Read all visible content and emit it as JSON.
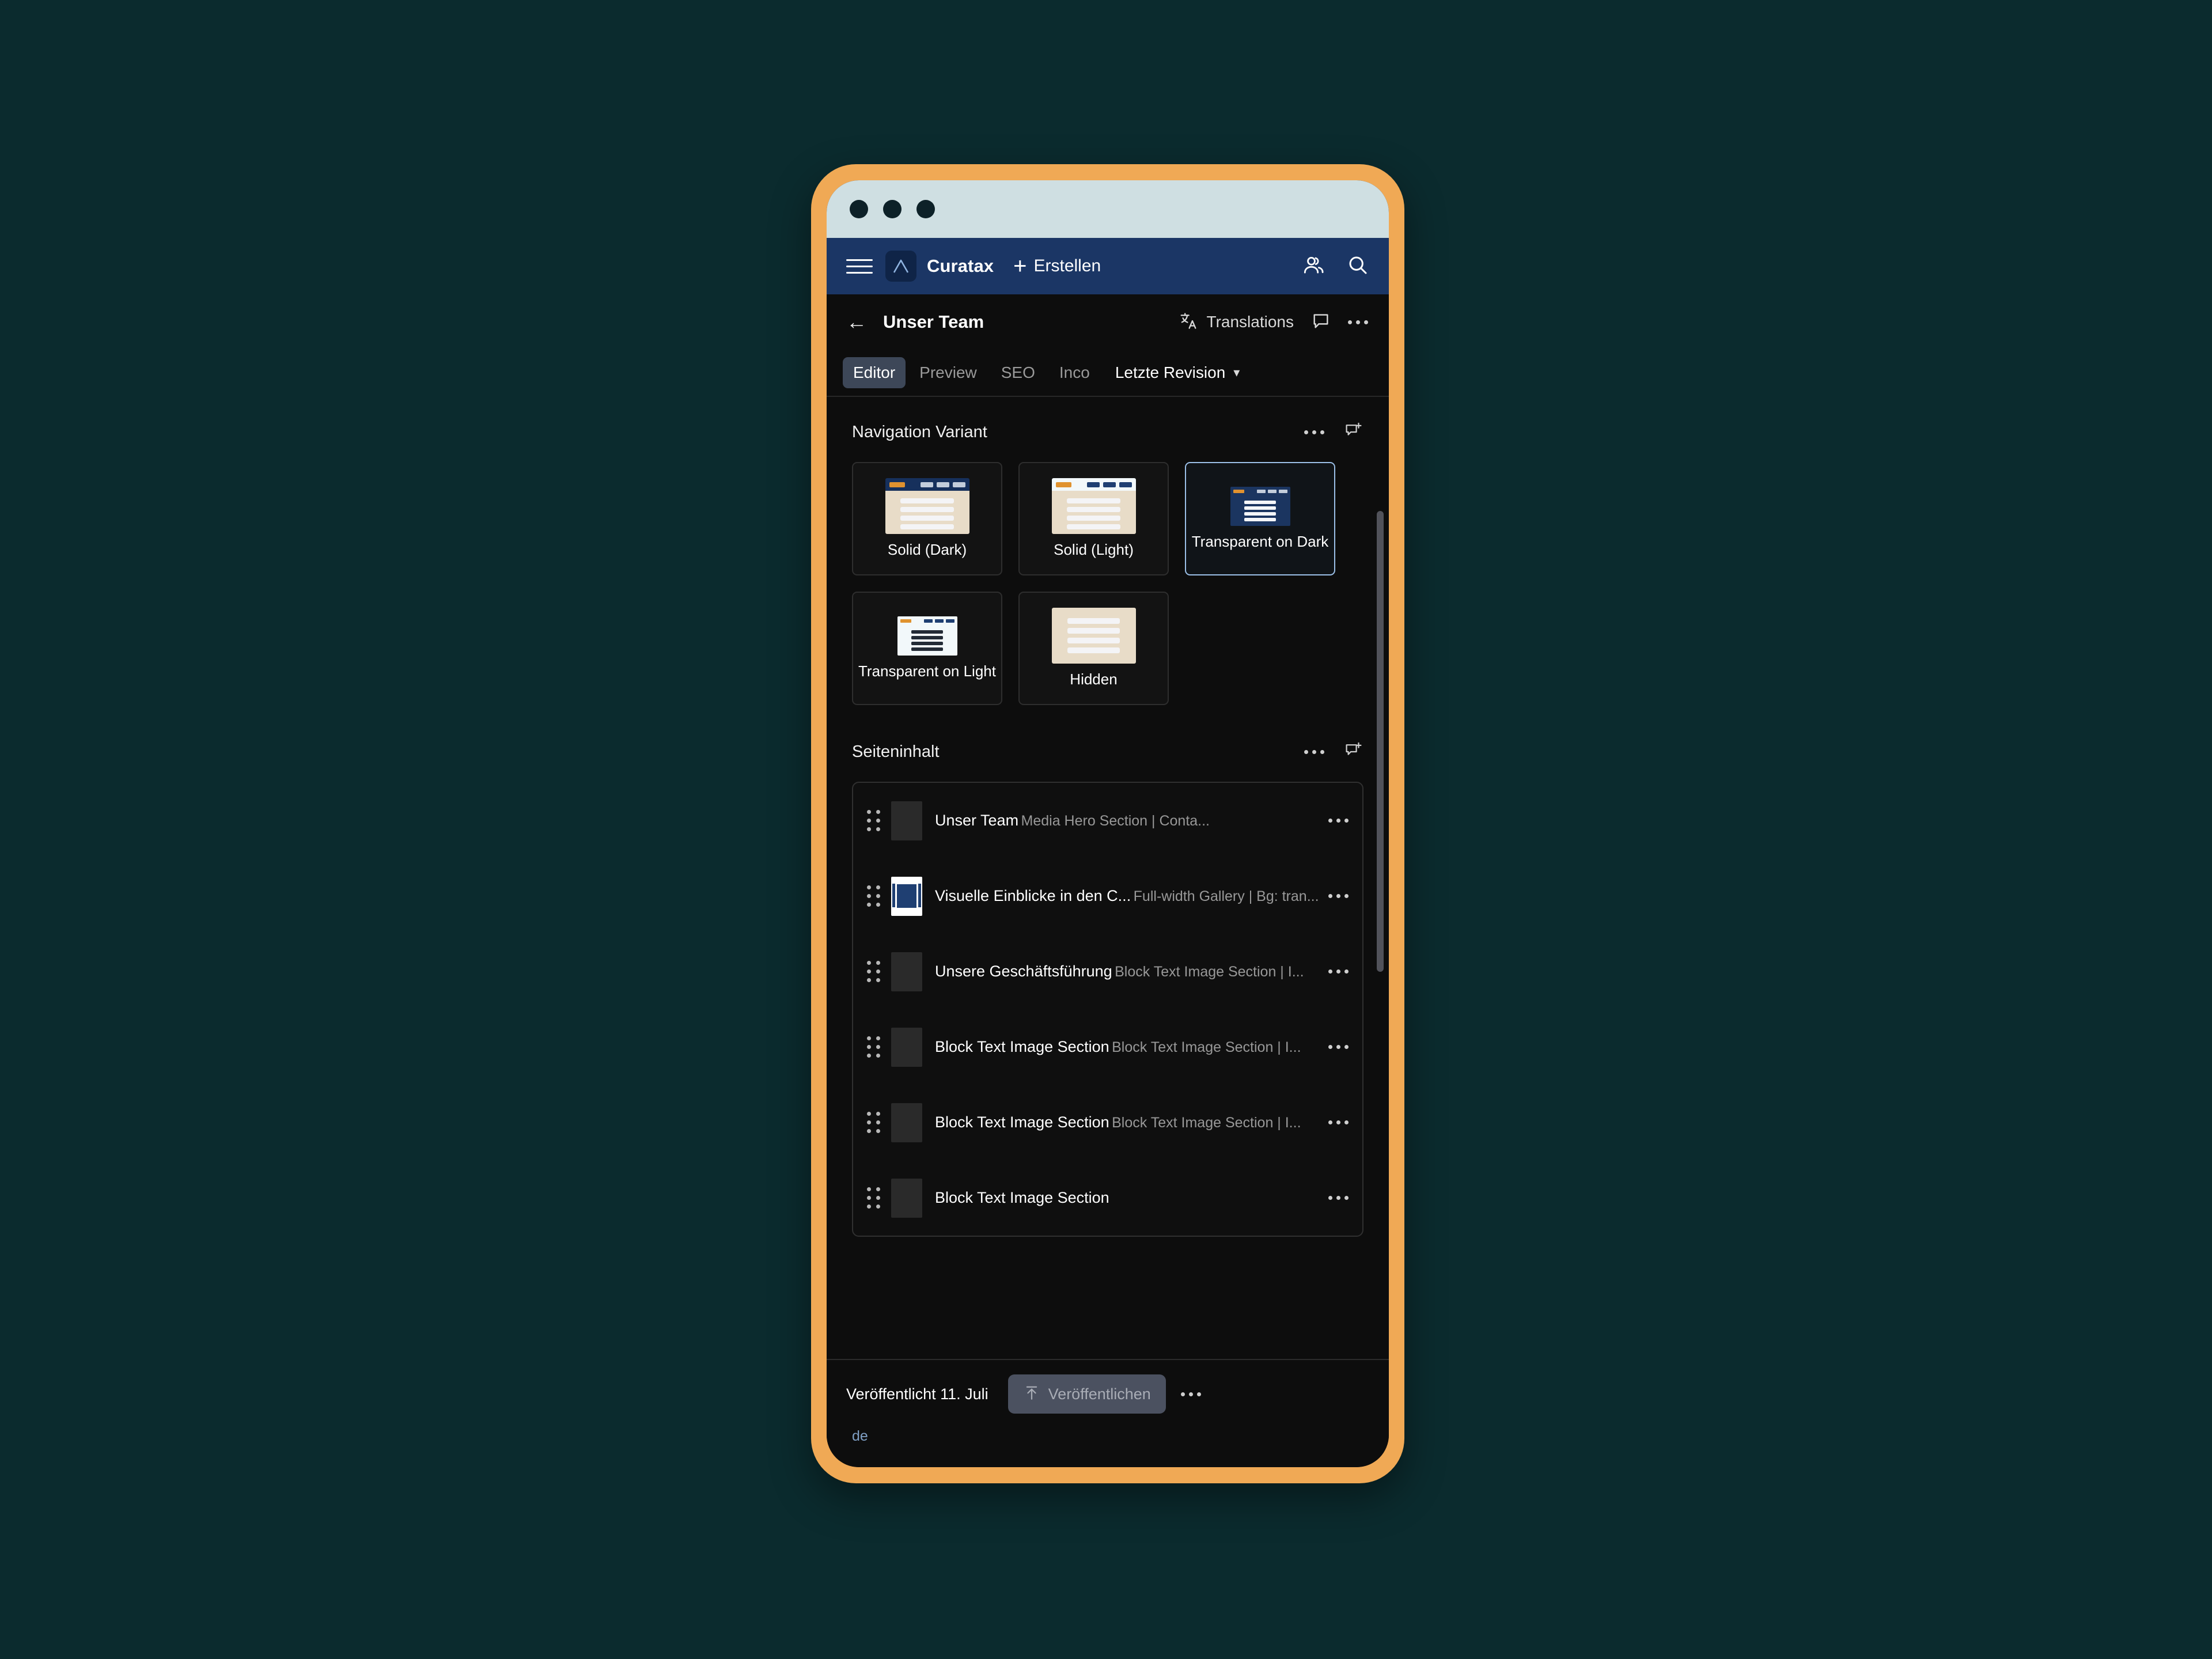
{
  "colors": {
    "page_background": "#0b2b2e",
    "frame": "#f0a955",
    "browser_chrome": "#cfdfe2",
    "app_bar": "#1b3665",
    "screen": "#0d0d0d",
    "accent_orange": "#e0922f",
    "accent_blue": "#1f3f72",
    "selected_border": "#9cc0e8"
  },
  "browser": {
    "dots": [
      "close",
      "minimize",
      "maximize"
    ]
  },
  "topbar": {
    "menu_icon": "hamburger-icon",
    "logo_icon": "curatax-logo-icon",
    "brand": "Curatax",
    "create_label": "Erstellen",
    "create_icon": "plus-icon",
    "people_icon": "people-icon",
    "search_icon": "search-icon"
  },
  "header": {
    "back_icon": "back-arrow-icon",
    "title": "Unser Team",
    "translations_label": "Translations",
    "translations_icon": "translate-icon",
    "comment_icon": "comment-icon",
    "more_icon": "more-icon"
  },
  "tabs": {
    "items": [
      {
        "label": "Editor",
        "active": true
      },
      {
        "label": "Preview",
        "active": false
      },
      {
        "label": "SEO",
        "active": false
      },
      {
        "label": "Inco",
        "active": false
      }
    ],
    "revision_label": "Letzte Revision",
    "revision_chevron": "chevron-down-icon"
  },
  "navigation_variant": {
    "title": "Navigation Variant",
    "more_icon": "more-icon",
    "comment_add_icon": "comment-add-icon",
    "options": [
      {
        "label": "Solid (Dark)",
        "thumb": "full-dark",
        "selected": false
      },
      {
        "label": "Solid (Light)",
        "thumb": "full-light",
        "selected": false
      },
      {
        "label": "Transparent on Dark",
        "thumb": "small-dark",
        "selected": true
      },
      {
        "label": "Transparent on Light",
        "thumb": "small-light",
        "selected": false
      },
      {
        "label": "Hidden",
        "thumb": "hidden",
        "selected": false
      }
    ]
  },
  "page_content": {
    "title": "Seiteninhalt",
    "more_icon": "more-icon",
    "comment_add_icon": "comment-add-icon",
    "items": [
      {
        "title": "Unser Team",
        "subtitle": "Media Hero Section | Conta...",
        "thumb": "crowd",
        "menu_icon": "more-icon",
        "drag_icon": "drag-handle-icon"
      },
      {
        "title": "Visuelle Einblicke in den C...",
        "subtitle": "Full-width Gallery | Bg: tran...",
        "thumb": "gallery",
        "menu_icon": "more-icon",
        "drag_icon": "drag-handle-icon"
      },
      {
        "title": "Unsere Geschäftsführung",
        "subtitle": "Block Text Image Section | I...",
        "thumb": "person-gray",
        "menu_icon": "more-icon",
        "drag_icon": "drag-handle-icon"
      },
      {
        "title": "Block Text Image Section",
        "subtitle": "Block Text Image Section | I...",
        "thumb": "person-red-tie",
        "menu_icon": "more-icon",
        "drag_icon": "drag-handle-icon"
      },
      {
        "title": "Block Text Image Section",
        "subtitle": "Block Text Image Section | I...",
        "thumb": "person-pink-tie",
        "menu_icon": "more-icon",
        "drag_icon": "drag-handle-icon"
      },
      {
        "title": "Block Text Image Section",
        "subtitle": "",
        "thumb": "person-gray",
        "menu_icon": "more-icon",
        "drag_icon": "drag-handle-icon"
      }
    ]
  },
  "bottom": {
    "status": "Veröffentlicht 11. Juli",
    "publish_label": "Veröffentlichen",
    "publish_icon": "upload-icon",
    "more_icon": "more-icon",
    "language": "de"
  }
}
